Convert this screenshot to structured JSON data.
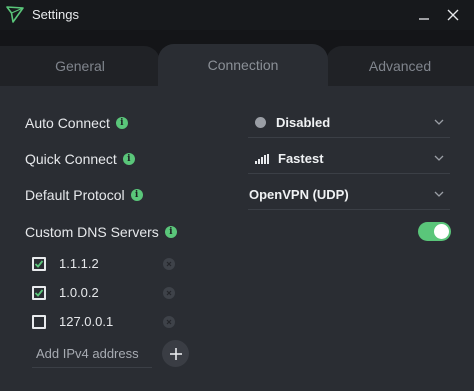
{
  "window": {
    "title": "Settings",
    "icon": "protonvpn-logo-icon",
    "controls": [
      "minimize-icon",
      "close-icon"
    ]
  },
  "tabs": [
    {
      "label": "General",
      "active": false
    },
    {
      "label": "Connection",
      "active": true
    },
    {
      "label": "Advanced",
      "active": false
    }
  ],
  "settings": {
    "auto_connect": {
      "label": "Auto Connect",
      "value": "Disabled"
    },
    "quick_connect": {
      "label": "Quick Connect",
      "value": "Fastest"
    },
    "default_protocol": {
      "label": "Default Protocol",
      "value": "OpenVPN (UDP)"
    },
    "custom_dns": {
      "label": "Custom DNS Servers",
      "enabled": true
    }
  },
  "dns_servers": [
    {
      "ip": "1.1.1.2",
      "checked": true
    },
    {
      "ip": "1.0.0.2",
      "checked": true
    },
    {
      "ip": "127.0.0.1",
      "checked": false
    }
  ],
  "add_dns": {
    "placeholder": "Add IPv4 address"
  },
  "colors": {
    "accent": "#5ac67a",
    "background": "#2a2d33",
    "titlebar": "#17191c"
  }
}
